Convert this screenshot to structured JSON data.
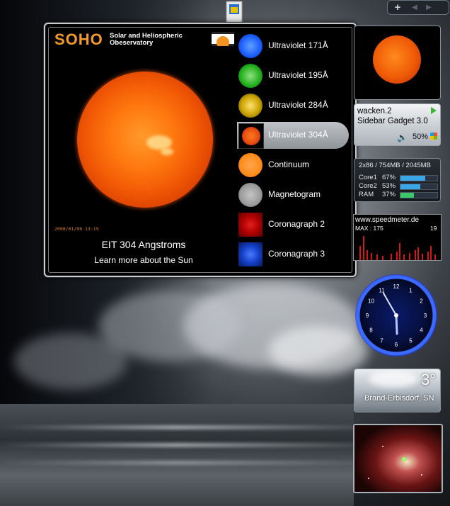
{
  "sidebar_controls": {
    "add": "+",
    "prev": "◀",
    "next": "▶"
  },
  "soho": {
    "logo": "SOHO",
    "subtitle_line1": "Solar and Heliospheric",
    "subtitle_line2": "Obeservatory",
    "timestamp": "2008/01/08 13:19",
    "image_title": "EIT 304 Angstroms",
    "learn_more": "Learn more about the Sun",
    "items": [
      {
        "label": "Ultraviolet 171Å",
        "color": "#1a5cff"
      },
      {
        "label": "Ultraviolet 195Å",
        "color": "#1fae1a"
      },
      {
        "label": "Ultraviolet 284Å",
        "color": "#c9a200"
      },
      {
        "label": "Ultraviolet 304Å",
        "color": "#e54a10",
        "selected": true
      },
      {
        "label": "Continuum",
        "color": "#ff8c1a"
      },
      {
        "label": "Magnetogram",
        "color": "#9a9a9a"
      },
      {
        "label": "Coronagraph 2",
        "color": "#b00000"
      },
      {
        "label": "Coronagraph 3",
        "color": "#1440c8"
      }
    ]
  },
  "media_gadget": {
    "line1": "wacken.2",
    "line2": "Sidebar Gadget 3.0",
    "volume": "50%"
  },
  "cpu_gadget": {
    "header": "2x86 / 754MB / 2045MB",
    "rows": [
      {
        "label": "Core1",
        "value": "67%",
        "level": 0.67,
        "color": "#3aa6e6"
      },
      {
        "label": "Core2",
        "value": "53%",
        "level": 0.53,
        "color": "#3aa6e6"
      },
      {
        "label": "RAM",
        "value": "37%",
        "level": 0.37,
        "color": "#3ac86a"
      }
    ]
  },
  "speed_gadget": {
    "site": "www.speedmeter.de",
    "max": "MAX : 175",
    "current": "19"
  },
  "clock": {
    "hour": 5,
    "minute": 55,
    "numbers": [
      "12",
      "1",
      "2",
      "3",
      "4",
      "5",
      "6",
      "7",
      "8",
      "9",
      "10",
      "11"
    ]
  },
  "weather": {
    "temp": "3°",
    "location": "Brand-Erbisdorf, SN"
  }
}
